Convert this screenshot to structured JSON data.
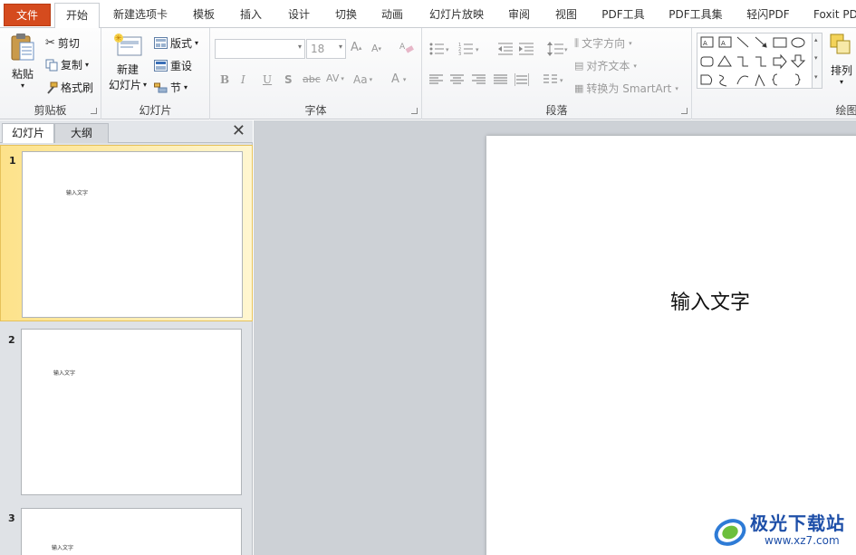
{
  "tabs": {
    "file": "文件",
    "home": "开始",
    "new_tab": "新建选项卡",
    "template": "模板",
    "insert": "插入",
    "design": "设计",
    "transition": "切换",
    "animation": "动画",
    "slideshow": "幻灯片放映",
    "review": "审阅",
    "view": "视图",
    "pdf_tools": "PDF工具",
    "pdf_toolset": "PDF工具集",
    "qingshan_pdf": "轻闪PDF",
    "foxit": "Foxit PD"
  },
  "clipboard": {
    "paste": "粘贴",
    "cut": "剪切",
    "copy": "复制",
    "format_painter": "格式刷",
    "label": "剪贴板"
  },
  "slides_group": {
    "new_slide_line1": "新建",
    "new_slide_line2": "幻灯片",
    "layout": "版式",
    "reset": "重设",
    "section": "节",
    "label": "幻灯片"
  },
  "font": {
    "size": "18",
    "bold": "B",
    "italic": "I",
    "underline": "U",
    "shadow": "S",
    "strike": "abc",
    "spacing": "AV",
    "case": "Aa",
    "color": "A",
    "grow": "A",
    "shrink": "A",
    "label": "字体"
  },
  "paragraph": {
    "text_direction": "文字方向",
    "align_text": "对齐文本",
    "smartart": "转换为 SmartArt",
    "label": "段落"
  },
  "drawing": {
    "arrange": "排列",
    "label": "绘图"
  },
  "pane": {
    "tab_slides": "幻灯片",
    "tab_outline": "大纲",
    "close": "✕"
  },
  "thumbnails": [
    {
      "num": "1",
      "text": "输入文字"
    },
    {
      "num": "2",
      "text": "输入文字"
    },
    {
      "num": "3",
      "text": "输入文字"
    }
  ],
  "slide": {
    "text": "输入文字"
  },
  "watermark": {
    "title": "极光下载站",
    "url": "www.xz7.com"
  },
  "colors": {
    "file_tab": "#d54b1e",
    "accent": "#c8262a",
    "selected_thumb": "#fde28a",
    "watermark": "#1e4fa8"
  }
}
